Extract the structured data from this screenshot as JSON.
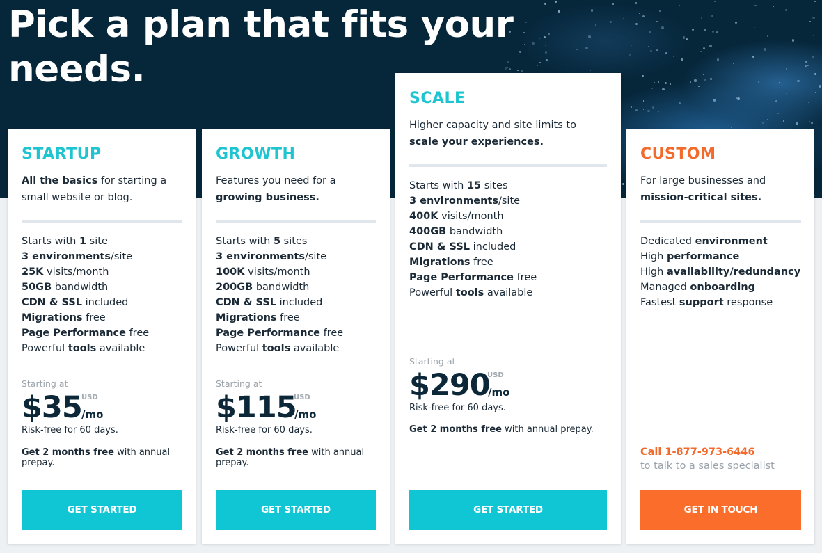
{
  "hero": {
    "title": "Pick a plan that fits your needs."
  },
  "colors": {
    "teal": "#11c6d4",
    "orange": "#fb6d2b",
    "navy": "#06263a",
    "text": "#1b2a36"
  },
  "plans": [
    {
      "name": "STARTUP",
      "desc_bold": "All the basics",
      "desc_rest": " for starting a small website or blog.",
      "features": [
        {
          "pre": "Starts with ",
          "bold": "1",
          "post": " site"
        },
        {
          "pre": "",
          "bold": "3 environments",
          "post": "/site"
        },
        {
          "pre": "",
          "bold": "25K",
          "post": " visits/month"
        },
        {
          "pre": "",
          "bold": "50GB",
          "post": " bandwidth"
        },
        {
          "pre": "",
          "bold": "CDN & SSL",
          "post": " included"
        },
        {
          "pre": "",
          "bold": "Migrations",
          "post": " free"
        },
        {
          "pre": "",
          "bold": "Page Performance",
          "post": " free"
        },
        {
          "pre": "Powerful ",
          "bold": "tools",
          "post": " available"
        }
      ],
      "starting_label": "Starting at",
      "price": "$35",
      "currency": "USD",
      "period": "/mo",
      "risk": "Risk-free for 60 days.",
      "promo_bold": "Get 2 months free",
      "promo_rest": " with annual prepay.",
      "button": "GET STARTED"
    },
    {
      "name": "GROWTH",
      "desc_pre": "Features you need for a ",
      "desc_bold": "growing business.",
      "features": [
        {
          "pre": "Starts with ",
          "bold": "5",
          "post": " sites"
        },
        {
          "pre": "",
          "bold": "3 environments",
          "post": "/site"
        },
        {
          "pre": "",
          "bold": "100K",
          "post": " visits/month"
        },
        {
          "pre": "",
          "bold": "200GB",
          "post": " bandwidth"
        },
        {
          "pre": "",
          "bold": "CDN & SSL",
          "post": " included"
        },
        {
          "pre": "",
          "bold": "Migrations",
          "post": " free"
        },
        {
          "pre": "",
          "bold": "Page Performance",
          "post": " free"
        },
        {
          "pre": "Powerful ",
          "bold": "tools",
          "post": " available"
        }
      ],
      "starting_label": "Starting at",
      "price": "$115",
      "currency": "USD",
      "period": "/mo",
      "risk": "Risk-free for 60 days.",
      "promo_bold": "Get 2 months free",
      "promo_rest": " with annual prepay.",
      "button": "GET STARTED"
    },
    {
      "name": "SCALE",
      "desc_pre": "Higher capacity and site limits to ",
      "desc_bold": "scale your experiences.",
      "features": [
        {
          "pre": "Starts with ",
          "bold": "15",
          "post": " sites"
        },
        {
          "pre": "",
          "bold": "3 environments",
          "post": "/site"
        },
        {
          "pre": "",
          "bold": "400K",
          "post": " visits/month"
        },
        {
          "pre": "",
          "bold": "400GB",
          "post": " bandwidth"
        },
        {
          "pre": "",
          "bold": "CDN & SSL",
          "post": " included"
        },
        {
          "pre": "",
          "bold": "Migrations",
          "post": " free"
        },
        {
          "pre": "",
          "bold": "Page Performance",
          "post": " free"
        },
        {
          "pre": "Powerful ",
          "bold": "tools",
          "post": " available"
        }
      ],
      "starting_label": "Starting at",
      "price": "$290",
      "currency": "USD",
      "period": "/mo",
      "risk": "Risk-free for 60 days.",
      "promo_bold": "Get 2 months free",
      "promo_rest": " with annual prepay.",
      "button": "GET STARTED"
    },
    {
      "name": "CUSTOM",
      "desc_pre": "For large businesses and ",
      "desc_bold": "mission-critical sites.",
      "features": [
        {
          "pre": "Dedicated ",
          "bold": "environment",
          "post": ""
        },
        {
          "pre": "High ",
          "bold": "performance",
          "post": ""
        },
        {
          "pre": "High ",
          "bold": "availability/redundancy",
          "post": ""
        },
        {
          "pre": "Managed ",
          "bold": "onboarding",
          "post": ""
        },
        {
          "pre": "Fastest ",
          "bold": "support",
          "post": " response"
        }
      ],
      "call_label": "Call 1-877-973-6446",
      "call_sub": "to talk to a sales specialist",
      "button": "GET IN TOUCH"
    }
  ]
}
